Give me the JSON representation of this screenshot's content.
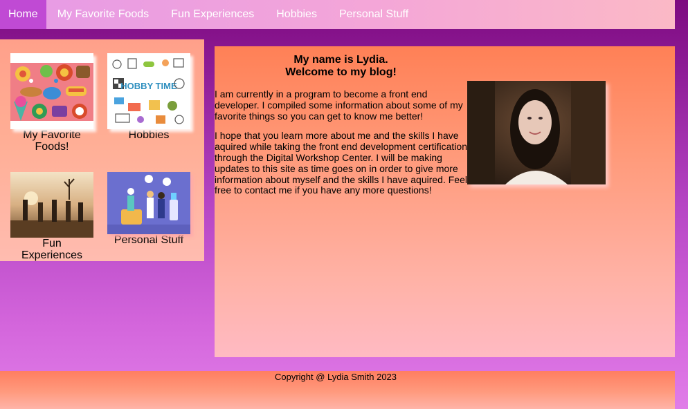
{
  "nav": {
    "items": [
      {
        "label": "Home"
      },
      {
        "label": "My Favorite Foods"
      },
      {
        "label": "Fun Experiences"
      },
      {
        "label": "Hobbies"
      },
      {
        "label": "Personal Stuff"
      }
    ]
  },
  "sidebar": {
    "cards": [
      {
        "label": "My Favorite Foods!"
      },
      {
        "label": "Hobbies"
      },
      {
        "label": "Fun Experiences"
      },
      {
        "label": "Personal Stuff"
      }
    ],
    "hobby_art_text": "HOBBY TIME"
  },
  "main": {
    "heading_line1": "My name is Lydia.",
    "heading_line2": "Welcome to my blog!",
    "paragraph1": "I am currently in a program to become a front end developer. I compiled some information about some of my favorite things so you can get to know me better!",
    "paragraph2": "I hope that you learn more about me and the skills I have aquired while taking the front end development certification through the Digital Workshop Center. I will be making updates to this site as time goes on in order to give more information about myself and the skills I have aquired. Feel free to contact me if you have any more questions!"
  },
  "footer": {
    "copyright": "Copyright @ Lydia Smith 2023"
  },
  "colors": {
    "nav_active": "#c04ad4",
    "page_purple": "#7d0a80",
    "panel_salmon": "#ff8056"
  }
}
